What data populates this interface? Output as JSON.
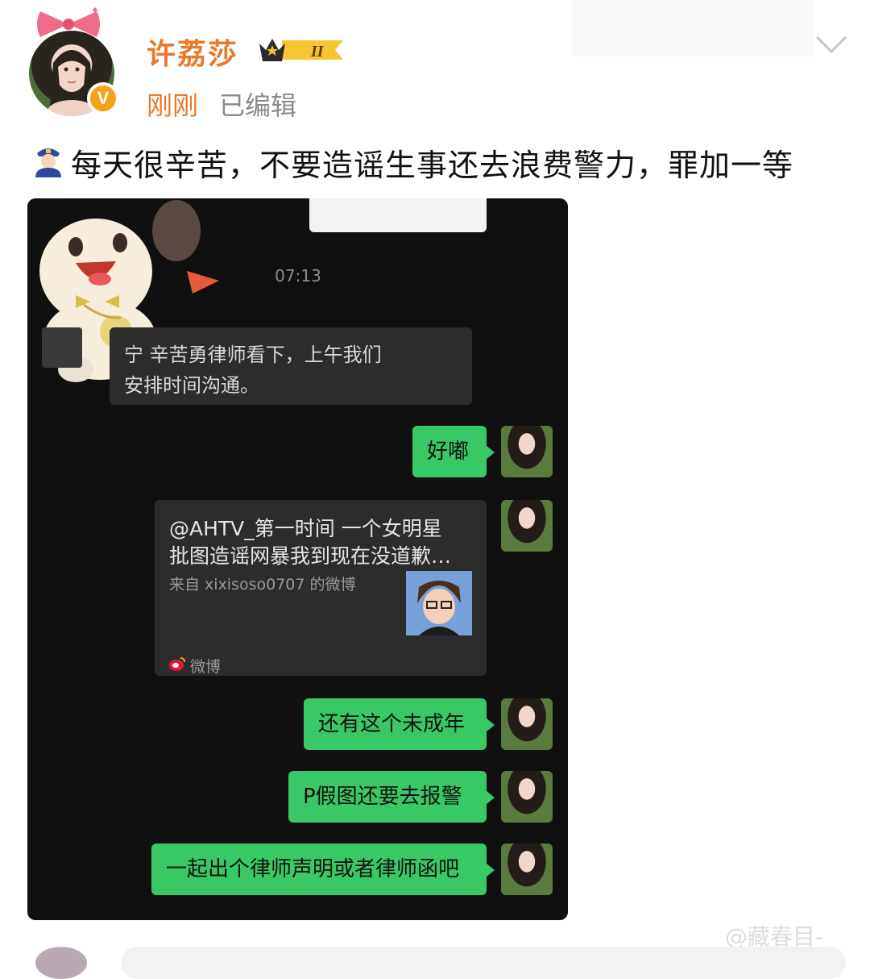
{
  "post": {
    "username": "许荔莎",
    "level_badge": "II",
    "time": "刚刚",
    "edited": "已编辑",
    "text": "每天很辛苦，不要造谣生事还去浪费警力，罪加一等",
    "emoji_icon": "police-officer-emoji",
    "verified_icon": "v-verified-icon",
    "username_color": "#e8792a"
  },
  "chat": {
    "timestamp": "07:13",
    "incoming_message": {
      "line1": "宁 辛苦勇律师看下，上午我们",
      "line2": "安排时间沟通。"
    },
    "outgoing_messages": [
      "好嘟",
      "还有这个未成年",
      "P假图还要去报警",
      "一起出个律师声明或者律师函吧"
    ],
    "shared_post": {
      "line1": "@AHTV_第一时间 一个女明星",
      "line2": "批图造谣网暴我到现在没道歉…",
      "source": "来自 xixisoso0707 的微博",
      "app_name": "微博"
    },
    "bubble_color": "#38c966"
  },
  "watermark": "@藏春目-"
}
